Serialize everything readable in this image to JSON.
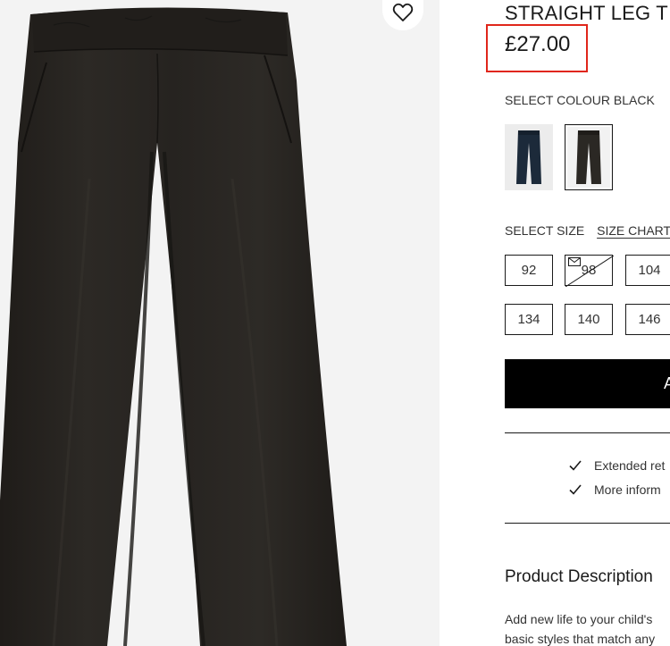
{
  "product": {
    "title": "STRAIGHT LEG T",
    "price": "£27.00",
    "colour_label": "SELECT COLOUR BLACK",
    "colours": [
      {
        "name": "navy",
        "hex": "#1c2a3a"
      },
      {
        "name": "black",
        "hex": "#2b2824",
        "selected": true
      }
    ],
    "size_label": "SELECT SIZE",
    "size_chart_link": "SIZE CHART",
    "sizes": [
      {
        "label": "92",
        "available": true
      },
      {
        "label": "98",
        "available": false
      },
      {
        "label": "104",
        "available": true
      },
      {
        "label": "134",
        "available": true
      },
      {
        "label": "140",
        "available": true
      },
      {
        "label": "146",
        "available": true
      }
    ],
    "add_to_bag_label": "A",
    "benefits": [
      "Extended ret",
      "More inform"
    ],
    "description_heading": "Product Description",
    "description_lines": [
      "Add new life to your child's",
      "basic styles that match any"
    ]
  },
  "icons": {
    "wishlist": "heart-outline-icon",
    "check": "checkmark-icon",
    "notify": "envelope-icon"
  },
  "colors": {
    "highlight": "#e0261b",
    "button_bg": "#000000",
    "image_bg": "#f3f3f3"
  }
}
